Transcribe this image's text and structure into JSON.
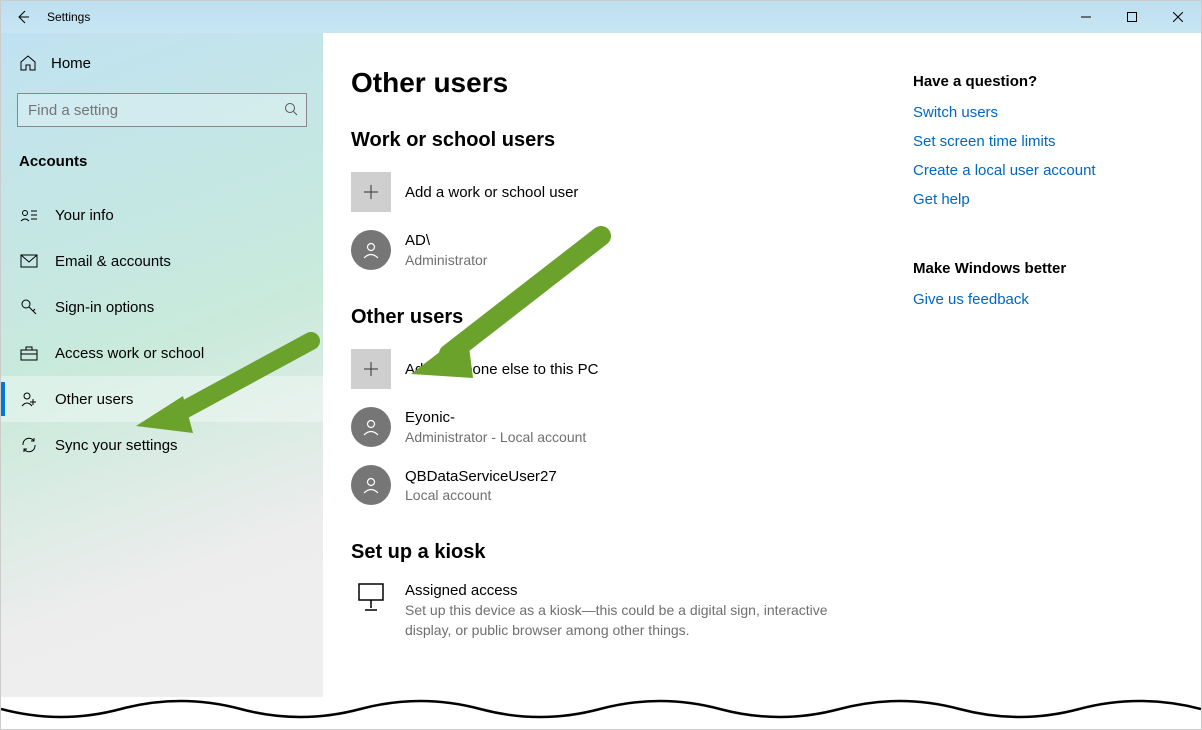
{
  "window": {
    "title": "Settings"
  },
  "sidebar": {
    "home": "Home",
    "search_placeholder": "Find a setting",
    "category": "Accounts",
    "items": [
      {
        "icon": "user-card-icon",
        "label": "Your info"
      },
      {
        "icon": "mail-icon",
        "label": "Email & accounts"
      },
      {
        "icon": "key-icon",
        "label": "Sign-in options"
      },
      {
        "icon": "briefcase-icon",
        "label": "Access work or school"
      },
      {
        "icon": "people-icon",
        "label": "Other users",
        "selected": true
      },
      {
        "icon": "sync-icon",
        "label": "Sync your settings"
      }
    ]
  },
  "page": {
    "title": "Other users",
    "sections": {
      "work_school": {
        "heading": "Work or school users",
        "add_label": "Add a work or school user",
        "users": [
          {
            "name": "AD\\",
            "role": "Administrator"
          }
        ]
      },
      "other": {
        "heading": "Other users",
        "add_label": "Add someone else to this PC",
        "users": [
          {
            "name": "Eyonic-",
            "role": "Administrator - Local account"
          },
          {
            "name": "QBDataServiceUser27",
            "role": "Local account"
          }
        ]
      },
      "kiosk": {
        "heading": "Set up a kiosk",
        "item_title": "Assigned access",
        "item_desc": "Set up this device as a kiosk—this could be a digital sign, interactive display, or public browser among other things."
      }
    }
  },
  "right": {
    "question_heading": "Have a question?",
    "links": [
      "Switch users",
      "Set screen time limits",
      "Create a local user account",
      "Get help"
    ],
    "better_heading": "Make Windows better",
    "feedback": "Give us feedback"
  }
}
